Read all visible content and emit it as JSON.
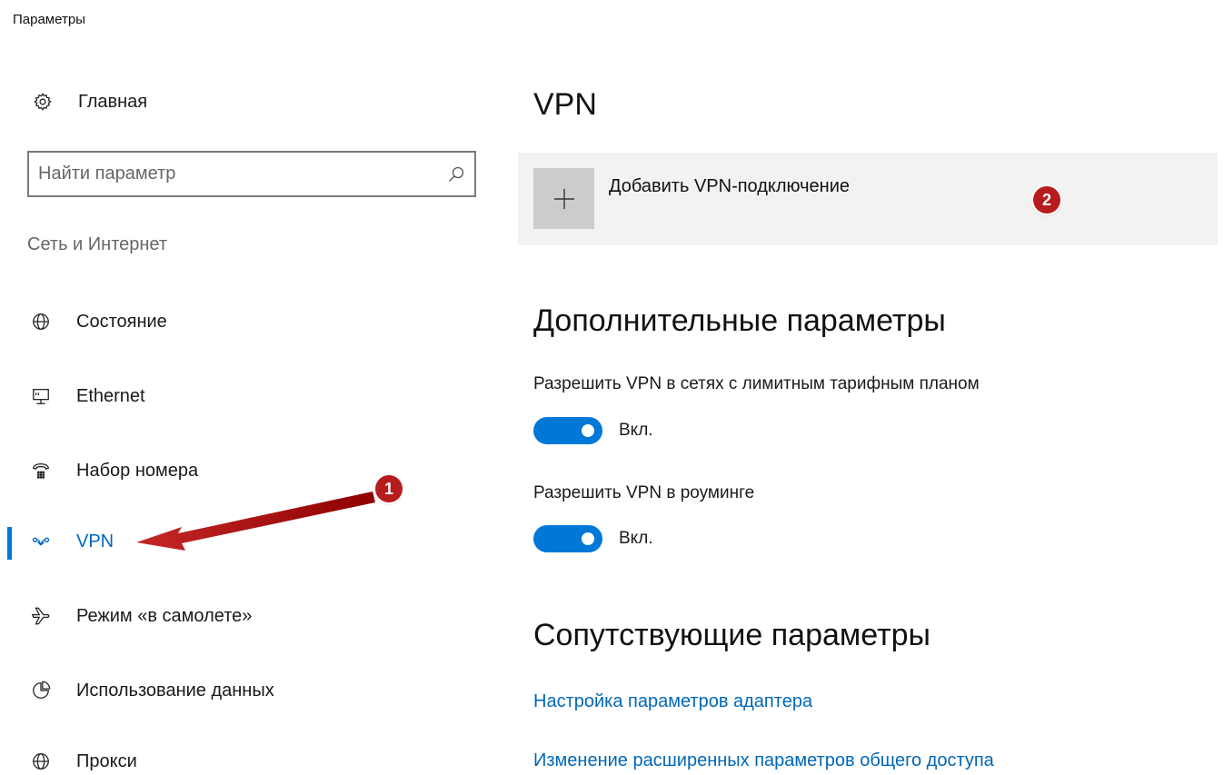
{
  "window": {
    "title": "Параметры"
  },
  "sidebar": {
    "home_label": "Главная",
    "search_placeholder": "Найти параметр",
    "section_label": "Сеть и Интернет",
    "items": [
      {
        "label": "Состояние",
        "icon": "globe-status-icon"
      },
      {
        "label": "Ethernet",
        "icon": "ethernet-icon"
      },
      {
        "label": "Набор номера",
        "icon": "dialup-icon"
      },
      {
        "label": "VPN",
        "icon": "vpn-icon",
        "active": true
      },
      {
        "label": "Режим «в самолете»",
        "icon": "airplane-icon"
      },
      {
        "label": "Использование данных",
        "icon": "data-usage-icon"
      },
      {
        "label": "Прокси",
        "icon": "globe-icon"
      }
    ]
  },
  "main": {
    "title": "VPN",
    "add_vpn_label": "Добавить VPN-подключение",
    "advanced_heading": "Дополнительные параметры",
    "settings": [
      {
        "label": "Разрешить VPN в сетях с лимитным тарифным планом",
        "state": "Вкл.",
        "on": true
      },
      {
        "label": "Разрешить VPN в роуминге",
        "state": "Вкл.",
        "on": true
      }
    ],
    "related_heading": "Сопутствующие параметры",
    "links": [
      "Настройка параметров адаптера",
      "Изменение расширенных параметров общего доступа"
    ]
  },
  "annotations": {
    "badge1": "1",
    "badge2": "2"
  },
  "colors": {
    "accent": "#0078d7",
    "link": "#0067b8",
    "annotation": "#b71c1c"
  }
}
